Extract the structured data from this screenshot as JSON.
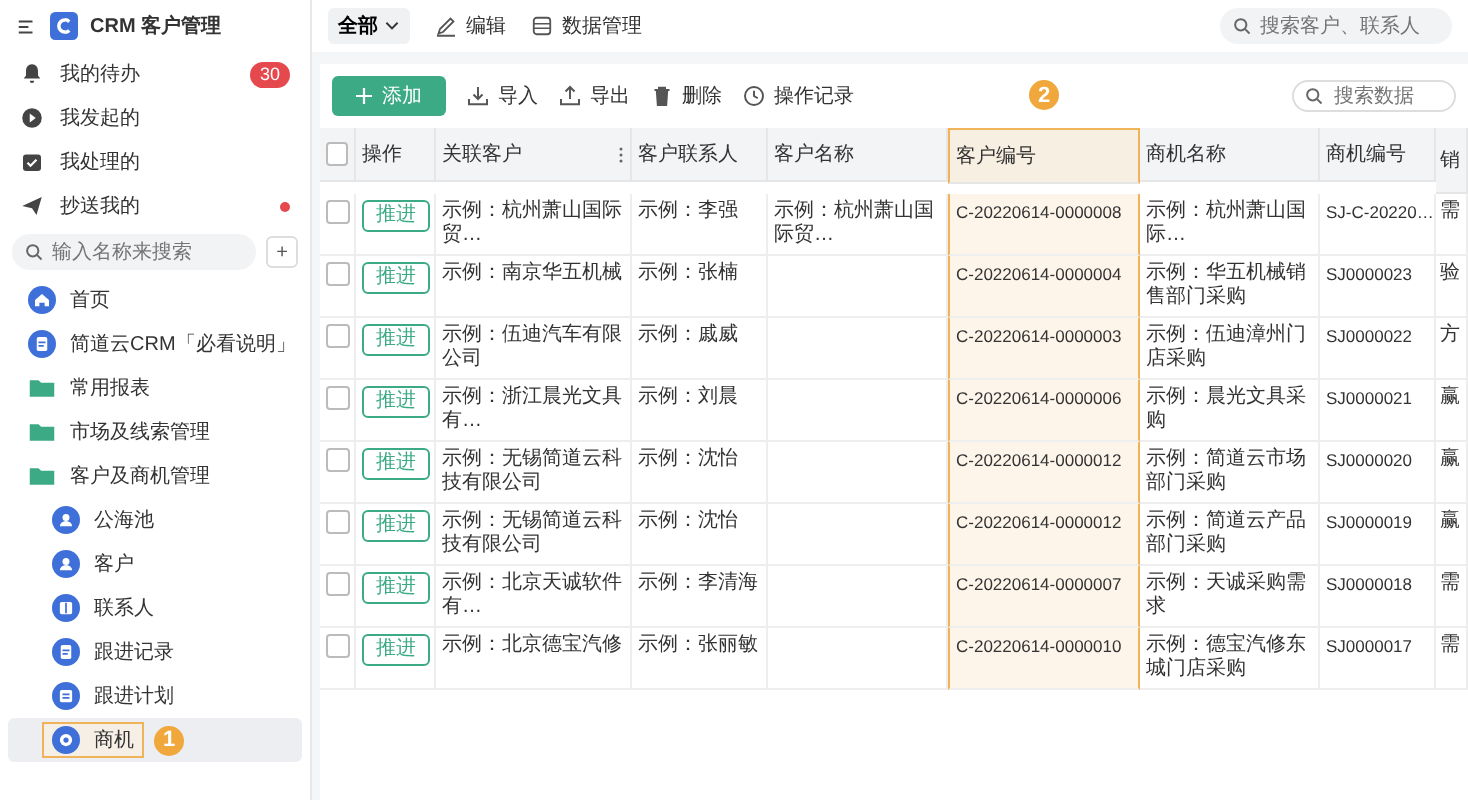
{
  "sidebar": {
    "title": "CRM 客户管理",
    "quick": [
      {
        "label": "我的待办",
        "badge": "30",
        "dot": false
      },
      {
        "label": "我发起的",
        "dot": false
      },
      {
        "label": "我处理的",
        "dot": false
      },
      {
        "label": "抄送我的",
        "dot": true
      }
    ],
    "search": {
      "placeholder": "输入名称来搜索"
    },
    "add": "+",
    "nav": [
      {
        "label": "首页",
        "selected": false
      },
      {
        "label": "简道云CRM「必看说明」",
        "selected": false
      },
      {
        "label": "常用报表",
        "kind": "folder",
        "selected": false
      },
      {
        "label": "市场及线索管理",
        "kind": "folder",
        "selected": false
      },
      {
        "label": "客户及商机管理",
        "kind": "folder",
        "selected": false,
        "children": [
          {
            "label": "公海池",
            "selected": false
          },
          {
            "label": "客户",
            "selected": false
          },
          {
            "label": "联系人",
            "selected": false
          },
          {
            "label": "跟进记录",
            "selected": false
          },
          {
            "label": "跟进计划",
            "selected": false
          },
          {
            "label": "商机",
            "selected": true,
            "marker": "1"
          }
        ]
      }
    ]
  },
  "topbar": {
    "filter": "全部",
    "actions": [
      "编辑",
      "数据管理"
    ],
    "search": {
      "placeholder": "搜索客户、联系人"
    }
  },
  "toolbar": {
    "add": "添加",
    "actions": [
      "导入",
      "导出",
      "删除",
      "操作记录"
    ],
    "search": {
      "placeholder": "搜索数据"
    }
  },
  "table": {
    "all_checked": false,
    "columns": [
      {
        "label": "操作",
        "menu": false,
        "highlighted": false
      },
      {
        "label": "关联客户",
        "menu": true,
        "highlighted": false
      },
      {
        "label": "客户联系人",
        "menu": false,
        "highlighted": false
      },
      {
        "label": "客户名称",
        "menu": false,
        "highlighted": false
      },
      {
        "label": "客户编号",
        "menu": false,
        "highlighted": true,
        "marker": "2"
      },
      {
        "label": "商机名称",
        "menu": false,
        "highlighted": false
      },
      {
        "label": "商机编号",
        "menu": false,
        "highlighted": false
      },
      {
        "label": "销",
        "menu": false,
        "highlighted": false
      }
    ],
    "rows": [
      {
        "checked": false,
        "cells": [
          "推进",
          "示例：杭州萧山国际贸…",
          "示例：李强",
          "示例：杭州萧山国际贸…",
          "C-20220614-0000008",
          "示例：杭州萧山国际…",
          "SJ-C-20220…",
          "需"
        ]
      },
      {
        "checked": false,
        "cells": [
          "推进",
          "示例：南京华五机械",
          "示例：张楠",
          "",
          "C-20220614-0000004",
          "示例：华五机械销售部门采购",
          "SJ0000023",
          "验"
        ]
      },
      {
        "checked": false,
        "cells": [
          "推进",
          "示例：伍迪汽车有限公司",
          "示例：戚威",
          "",
          "C-20220614-0000003",
          "示例：伍迪漳州门店采购",
          "SJ0000022",
          "方"
        ]
      },
      {
        "checked": false,
        "cells": [
          "推进",
          "示例：浙江晨光文具有…",
          "示例：刘晨",
          "",
          "C-20220614-0000006",
          "示例：晨光文具采购",
          "SJ0000021",
          "赢"
        ]
      },
      {
        "checked": false,
        "cells": [
          "推进",
          "示例：无锡简道云科技有限公司",
          "示例：沈怡",
          "",
          "C-20220614-0000012",
          "示例：简道云市场部门采购",
          "SJ0000020",
          "赢"
        ]
      },
      {
        "checked": false,
        "cells": [
          "推进",
          "示例：无锡简道云科技有限公司",
          "示例：沈怡",
          "",
          "C-20220614-0000012",
          "示例：简道云产品部门采购",
          "SJ0000019",
          "赢"
        ]
      },
      {
        "checked": false,
        "cells": [
          "推进",
          "示例：北京天诚软件有…",
          "示例：李清海",
          "",
          "C-20220614-0000007",
          "示例：天诚采购需求",
          "SJ0000018",
          "需"
        ]
      },
      {
        "checked": false,
        "cells": [
          "推进",
          "示例：北京德宝汽修",
          "示例：张丽敏",
          "",
          "C-20220614-0000010",
          "示例：德宝汽修东城门店采购",
          "SJ0000017",
          "需"
        ]
      }
    ]
  }
}
